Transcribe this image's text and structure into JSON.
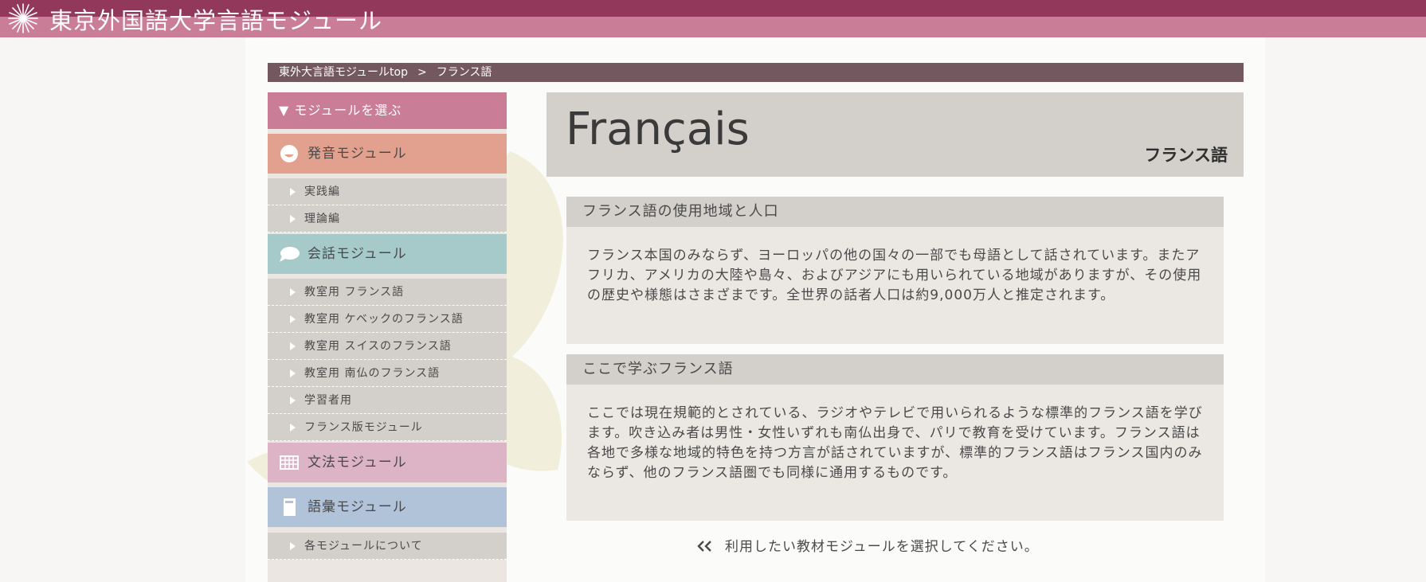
{
  "header": {
    "site_title": "東京外国語大学言語モジュール",
    "logo_icon": "starburst-logo-icon"
  },
  "breadcrumb": {
    "home": "東外大言語モジュールtop",
    "separator": ">",
    "current": "フランス語"
  },
  "sidebar": {
    "heading": "▼ モジュールを選ぶ",
    "pronunciation": {
      "label": "発音モジュール",
      "icon": "face-icon",
      "items": [
        "実践編",
        "理論編"
      ]
    },
    "conversation": {
      "label": "会話モジュール",
      "icon": "speech-bubble-icon",
      "items": [
        "教室用 フランス語",
        "教室用 ケベックのフランス語",
        "教室用 スイスのフランス語",
        "教室用 南仏のフランス語",
        "学習者用",
        "フランス版モジュール"
      ]
    },
    "grammar": {
      "label": "文法モジュール",
      "icon": "grid-icon"
    },
    "vocabulary": {
      "label": "語彙モジュール",
      "icon": "book-icon"
    },
    "about": "各モジュールについて"
  },
  "main": {
    "title": "Français",
    "subtitle": "フランス語",
    "sections": [
      {
        "heading": "フランス語の使用地域と人口",
        "body": "フランス本国のみならず、ヨーロッパの他の国々の一部でも母語として話されています。またアフリカ、アメリカの大陸や島々、およびアジアにも用いられている地域がありますが、その使用の歴史や様態はさまざまです。全世界の話者人口は約9,000万人と推定されます。"
      },
      {
        "heading": "ここで学ぶフランス語",
        "body": "ここでは現在規範的とされている、ラジオやテレビで用いられるような標準的フランス語を学びます。吹き込み者は男性・女性いずれも南仏出身で、パリで教育を受けています。フランス語は各地で多様な地域的特色を持つ方言が話されていますが、標準的フランス語はフランス国内のみならず、他のフランス語圏でも同様に通用するものです。"
      }
    ],
    "footer_note": "利用したい教材モジュールを選択してください。",
    "footer_icon": "double-chevron-left-icon"
  },
  "colors": {
    "header_dark": "#92385a",
    "header_light": "#c97d96",
    "breadcrumb": "#735860",
    "pronunciation": "#e2a18f",
    "conversation": "#a6c9c9",
    "grammar": "#ddb3c6",
    "vocabulary": "#b1c3d9"
  }
}
